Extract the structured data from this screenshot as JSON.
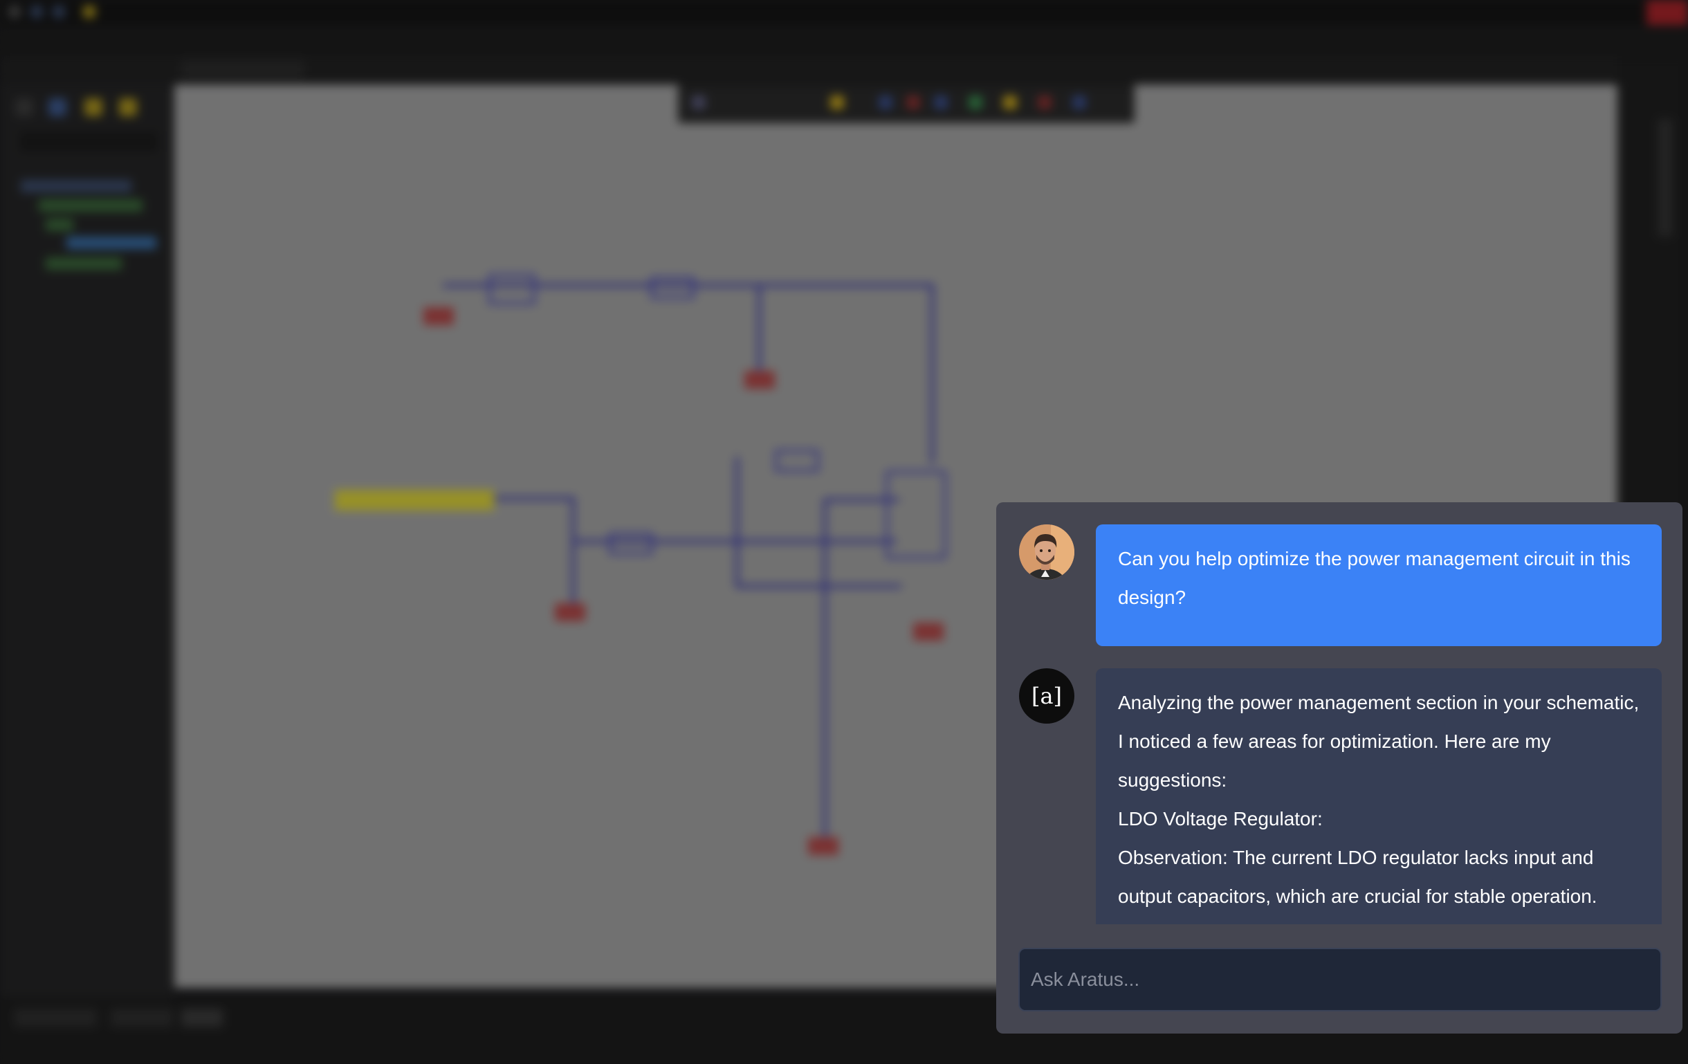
{
  "chat": {
    "user_message": "Can you help optimize the power management circuit in this design?",
    "assistant_avatar_text": "[a]",
    "assistant_paragraphs": [
      "Analyzing the power management section in your schematic, I noticed a few areas for optimization. Here are my suggestions:",
      "LDO Voltage Regulator:",
      "Observation: The current LDO regulator lacks input and output capacitors, which are crucial for stable operation."
    ],
    "input_placeholder": "Ask Aratus..."
  },
  "colors": {
    "user_bubble": "#3b82f6",
    "assistant_bubble": "#363e55",
    "panel_background": "#454651",
    "input_background": "#1f2738"
  },
  "icons": {
    "user_avatar": "person-photo-avatar",
    "assistant_avatar": "aratus-logo"
  }
}
